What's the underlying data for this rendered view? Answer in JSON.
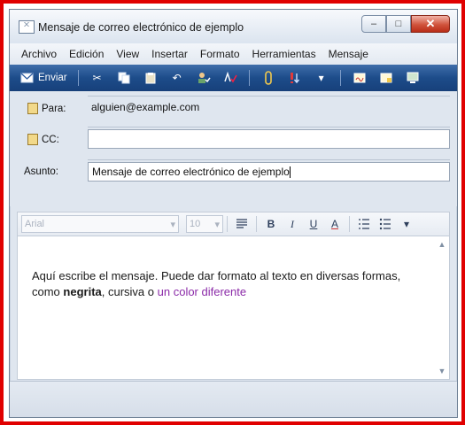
{
  "window": {
    "title": "Mensaje de correo electrónico de ejemplo",
    "minimize_glyph": "–",
    "maximize_glyph": "□",
    "close_glyph": "✕"
  },
  "menu": [
    "Archivo",
    "Edición",
    "View",
    "Insertar",
    "Formato",
    "Herramientas",
    "Mensaje"
  ],
  "toolbar": {
    "send_label": "Enviar",
    "icons": [
      "cut-icon",
      "copy-icon",
      "paste-icon",
      "undo-icon",
      "check-names-icon",
      "spelling-icon",
      "attach-icon",
      "priority-icon",
      "dropdown-icon",
      "signature-icon",
      "encrypt-icon",
      "offline-icon"
    ]
  },
  "headers": {
    "to_label": "Para:",
    "to_value": "alguien@example.com",
    "cc_label": "CC:",
    "cc_value": "",
    "subject_label": "Asunto:",
    "subject_value": "Mensaje de correo electrónico de ejemplo"
  },
  "formatting": {
    "font_name": "Arial",
    "font_size": "10",
    "bold": "B",
    "italic": "I",
    "underline": "U",
    "font_color": "A"
  },
  "body": {
    "part1": "Aquí escribe el mensaje. Puede dar formato al texto en diversas formas, como",
    "bold_text": "negrita",
    "part2": ", cursiva o",
    "colored_text": "un color diferente",
    "colored_hex": "#8b2aa8"
  },
  "colors": {
    "frame": "#e00000",
    "toolbar": "#1d4c8a"
  }
}
